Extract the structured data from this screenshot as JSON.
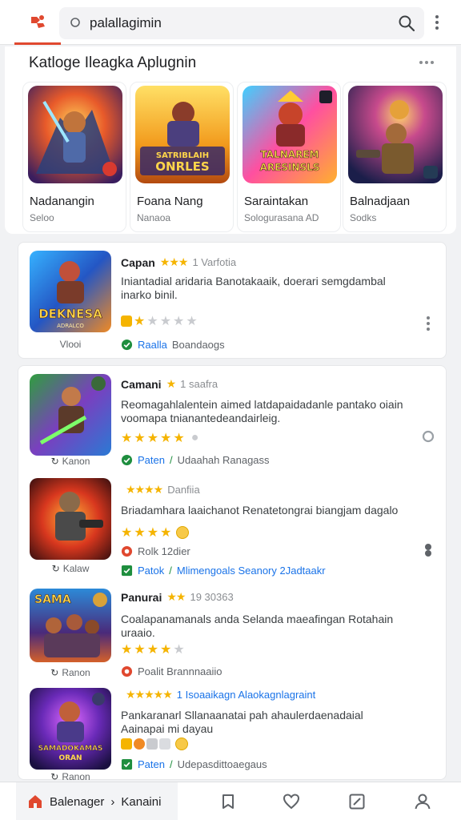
{
  "colors": {
    "accent": "#e0482f",
    "star": "#f5b400",
    "green": "#1e8e3e",
    "blue": "#1a73e8"
  },
  "topbar": {
    "logo_icon": "app-logo-icon",
    "search_value": "palallagimin",
    "search_icon": "search-icon",
    "more_icon": "more-vertical-icon"
  },
  "catalog": {
    "title": "Katloge Ileagka Aplugnin",
    "more_icon": "more-horizontal-icon",
    "items": [
      {
        "name": "Nadanangin",
        "sub": "Seloo"
      },
      {
        "name": "Foana Nang",
        "sub": "Nanaoa",
        "art_text_1": "SATRIBLAIH",
        "art_text_2": "ONRLES"
      },
      {
        "name": "Saraintakan",
        "sub": "Sologurasana  AD",
        "art_text_1": "TALNAREM",
        "art_text_2": "ARESINSLS"
      },
      {
        "name": "Balnadjaan",
        "sub": "Sodks"
      }
    ]
  },
  "list": [
    {
      "title": "Capan",
      "head_stars": "★★★",
      "meta": "1 Varfotia",
      "desc": "Iniantadial aridaria Banotakaaik, doerari semgdambal inarko binil.",
      "status_1": "Raalla",
      "status_2": "Boandaogs",
      "caption": "Vlooi",
      "art_text_1": "DEKNESA",
      "art_text_2": "ADRALCO",
      "rating": 2
    },
    {
      "title": "Camani",
      "head_stars": "★",
      "meta": "1 saafra",
      "desc": "Reomagahlalentein aimed latdapaidadanle pantako oiain voomapa tnianantedeandairleig.",
      "status_1": "Paten",
      "status_2": "Udaahah Ranagass",
      "caption": "Kanon",
      "rating": 5
    },
    {
      "title": "",
      "head_stars": "★★★★",
      "meta": "Danfiia",
      "desc": "Briadamhara laaichanot Renatetongrai biangjam dagalo",
      "status_1": "Rolk 12dier",
      "status_2": "Patok",
      "status_3": "Mlimengoals Seanory 2Jadtaakr",
      "caption": "Kalaw",
      "rating": 4
    },
    {
      "title": "Panurai",
      "head_stars": "★★",
      "meta": "19 30363",
      "desc": "Coalapanamanals anda Selanda maeafingan Rotahain uraaio.",
      "status_1": "Poalit Brannnaaiio",
      "caption": "Ranon",
      "art_text_1": "SAMA",
      "rating": 4
    },
    {
      "title": "",
      "head_stars": "★★★★★",
      "meta": "1 Isoaaikagn Alaokagnlagraint",
      "desc": "Pankaranarl Sllanaanatai pah ahaulerdaenadaial Aainapai mi dayau",
      "status_1": "Paten",
      "status_2": "Udepasdittoaegaus",
      "caption": "Ranon",
      "art_text_1": "SAMADOKAMAS",
      "art_text_2": "ORAN",
      "rating": 0
    }
  ],
  "bottomnav": {
    "home_label": "Balenager",
    "home_suffix": "Kanaini",
    "items": [
      "library-icon",
      "heart-icon",
      "edit-icon",
      "profile-icon"
    ]
  }
}
